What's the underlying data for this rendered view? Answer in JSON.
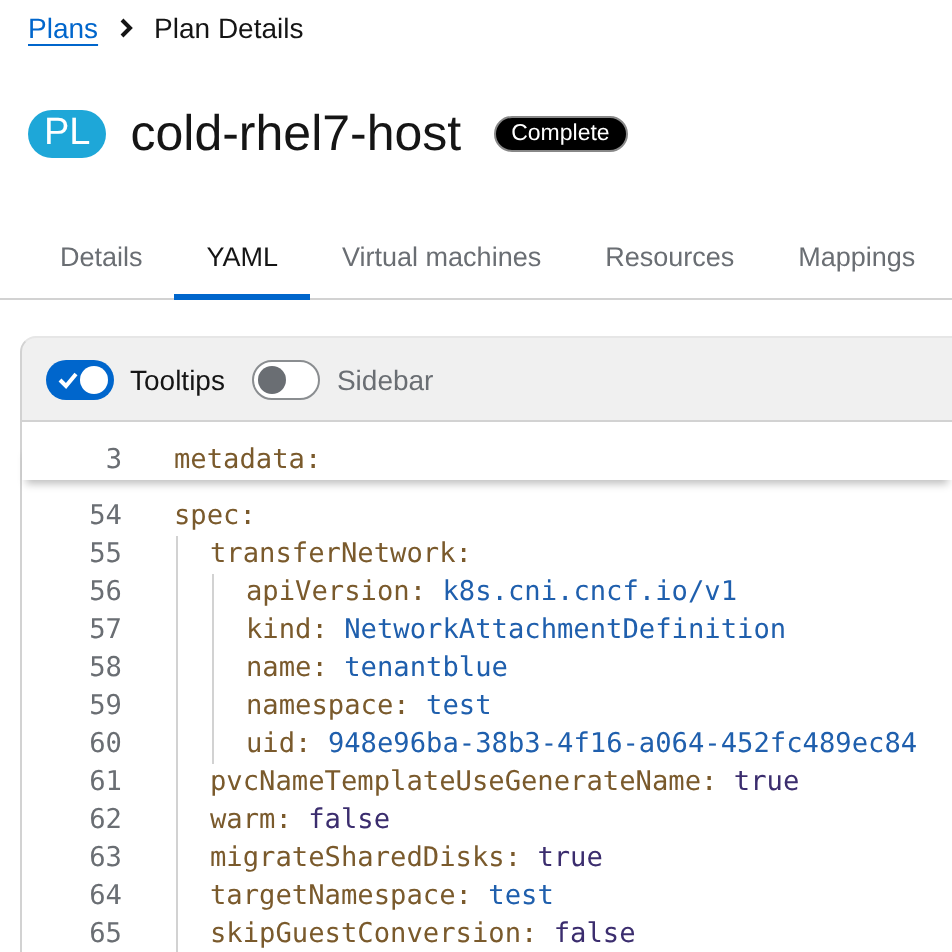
{
  "breadcrumb": {
    "items": [
      {
        "label": "Plans",
        "link": true
      },
      {
        "label": "Plan Details",
        "link": false
      }
    ]
  },
  "header": {
    "badge": "PL",
    "title": "cold-rhel7-host",
    "status": "Complete"
  },
  "tabs": [
    {
      "label": "Details",
      "selected": false
    },
    {
      "label": "YAML",
      "selected": true
    },
    {
      "label": "Virtual machines",
      "selected": false
    },
    {
      "label": "Resources",
      "selected": false
    },
    {
      "label": "Mappings",
      "selected": false
    }
  ],
  "editor": {
    "toggles": [
      {
        "label": "Tooltips",
        "on": true
      },
      {
        "label": "Sidebar",
        "on": false
      }
    ],
    "sticky_line": {
      "number": "3",
      "key": "metadata:"
    },
    "lines": [
      {
        "number": "54",
        "key": "spec:",
        "children": [
          {
            "number": "55",
            "key": "transferNetwork:",
            "children": [
              {
                "number": "56",
                "key": "apiVersion:",
                "value": "k8s.cni.cncf.io/v1",
                "kind": "string"
              },
              {
                "number": "57",
                "key": "kind:",
                "value": "NetworkAttachmentDefinition",
                "kind": "string"
              },
              {
                "number": "58",
                "key": "name:",
                "value": "tenantblue",
                "kind": "string"
              },
              {
                "number": "59",
                "key": "namespace:",
                "value": "test",
                "kind": "string"
              },
              {
                "number": "60",
                "key": "uid:",
                "value": "948e96ba-38b3-4f16-a064-452fc489ec84",
                "kind": "string"
              }
            ]
          },
          {
            "number": "61",
            "key": "pvcNameTemplateUseGenerateName:",
            "value": "true",
            "kind": "boolean"
          },
          {
            "number": "62",
            "key": "warm:",
            "value": "false",
            "kind": "boolean"
          },
          {
            "number": "63",
            "key": "migrateSharedDisks:",
            "value": "true",
            "kind": "boolean"
          },
          {
            "number": "64",
            "key": "targetNamespace:",
            "value": "test",
            "kind": "string"
          },
          {
            "number": "65",
            "key": "skipGuestConversion:",
            "value": "false",
            "kind": "boolean"
          }
        ]
      }
    ]
  }
}
